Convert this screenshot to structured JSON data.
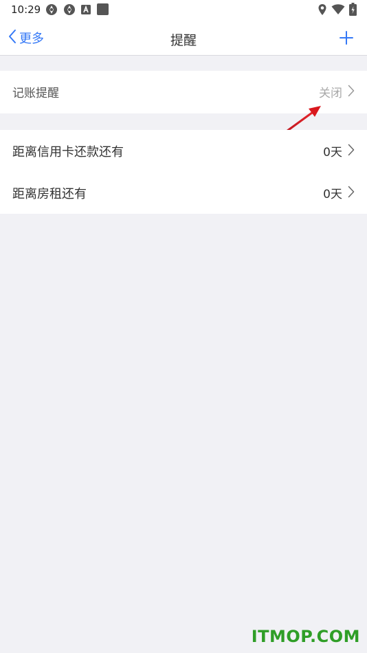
{
  "status_bar": {
    "time": "10:29",
    "left_icons": [
      "sync-icon",
      "sync-icon",
      "font-icon",
      "square-app-icon"
    ],
    "right_icons": [
      "location-icon",
      "wifi-icon",
      "battery-icon"
    ]
  },
  "nav": {
    "back_label": "更多",
    "title": "提醒",
    "add_icon": "plus-icon"
  },
  "sections": [
    {
      "rows": [
        {
          "label": "记账提醒",
          "value": "关闭",
          "value_muted": true
        }
      ]
    },
    {
      "rows": [
        {
          "label": "距离信用卡还款还有",
          "value": "0天",
          "value_muted": false
        },
        {
          "label": "距离房租还有",
          "value": "0天",
          "value_muted": false
        }
      ]
    }
  ],
  "watermark": "ITMOP.COM",
  "colors": {
    "accent": "#3478F6",
    "background": "#F1F1F5",
    "annotation_arrow": "#D9181E",
    "watermark": "#2F9E27"
  }
}
